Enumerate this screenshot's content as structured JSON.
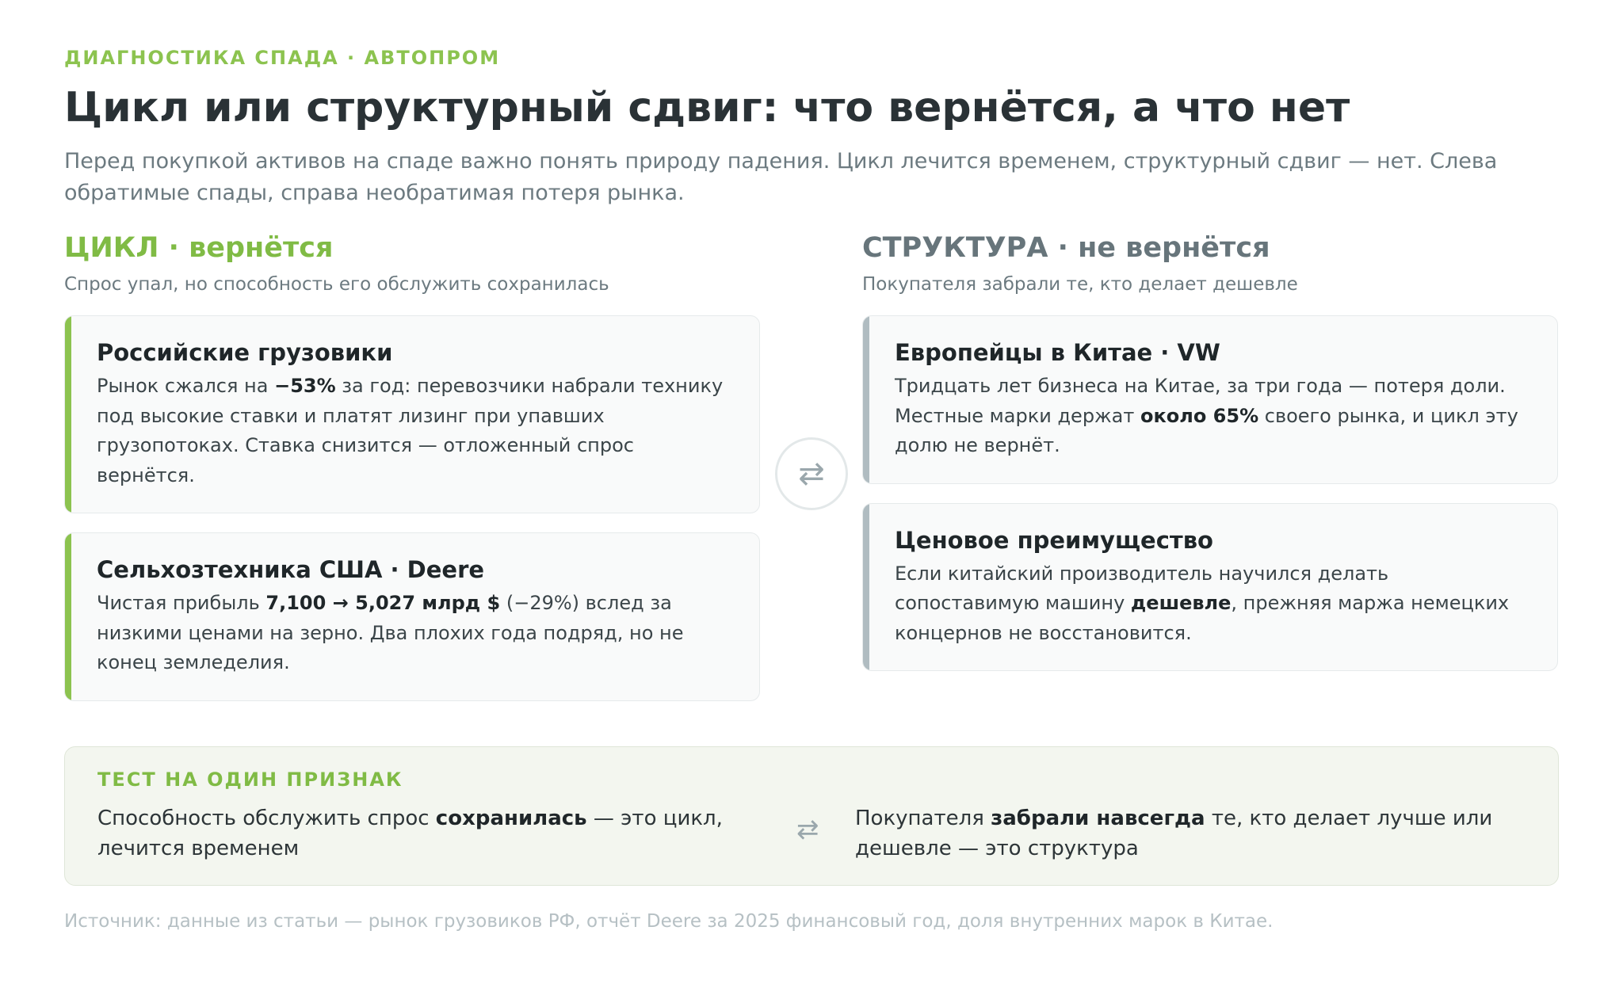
{
  "header": {
    "eyebrow": "ДИАГНОСТИКА СПАДА · АВТОПРОМ",
    "title": "Цикл или структурный сдвиг: что вернётся, а что нет",
    "lead": "Перед покупкой активов на спаде важно понять природу падения. Цикл лечится временем, структурный сдвиг — нет. Слева обратимые спады, справа необратимая потеря рынка."
  },
  "cycle": {
    "title": "ЦИКЛ · вернётся",
    "subtitle": "Спрос упал, но способность его обслужить сохранилась",
    "cards": [
      {
        "title": "Российские грузовики",
        "body_1": "Рынок сжался на ",
        "body_bold_1": "−53%",
        "body_2": " за год: перевозчики набрали технику под высокие ставки и платят лизинг при упавших грузопотоках. Ставка снизится — отложенный спрос вернётся."
      },
      {
        "title": "Сельхозтехника США · Deere",
        "body_1": "Чистая прибыль ",
        "body_bold_1": "7,100 → 5,027 млрд $",
        "body_2": " (−29%) вслед за низкими ценами на зерно. Два плохих года подряд, но не конец земледелия."
      }
    ]
  },
  "structure": {
    "title": "СТРУКТУРА · не вернётся",
    "subtitle": "Покупателя забрали те, кто делает дешевле",
    "cards": [
      {
        "title": "Европейцы в Китае · VW",
        "body_1": "Тридцать лет бизнеса на Китае, за три года — потеря доли. Местные марки держат ",
        "body_bold_1": "около 65%",
        "body_2": " своего рынка, и цикл эту долю не вернёт."
      },
      {
        "title": "Ценовое преимущество",
        "body_1": "Если китайский производитель научился делать сопоставимую машину ",
        "body_bold_1": "дешевле",
        "body_2": ", прежняя маржа немецких концернов не восстановится."
      }
    ]
  },
  "divider_icon": "swap-arrows-icon",
  "test": {
    "label": "ТЕСТ НА ОДИН ПРИЗНАК",
    "left_1": "Способность обслужить спрос ",
    "left_bold": "сохранилась",
    "left_2": " — это цикл, лечится временем",
    "right_1": "Покупателя ",
    "right_bold": "забрали навсегда",
    "right_2": " те, кто делает лучше или дешевле — это структура"
  },
  "source": "Источник: данные из статьи — рынок грузовиков РФ, отчёт Deere за 2025 финансовый год, доля внутренних марок в Китае.",
  "colors": {
    "accent_green": "#8cc34f",
    "structure_gray": "#b0bcc1"
  }
}
